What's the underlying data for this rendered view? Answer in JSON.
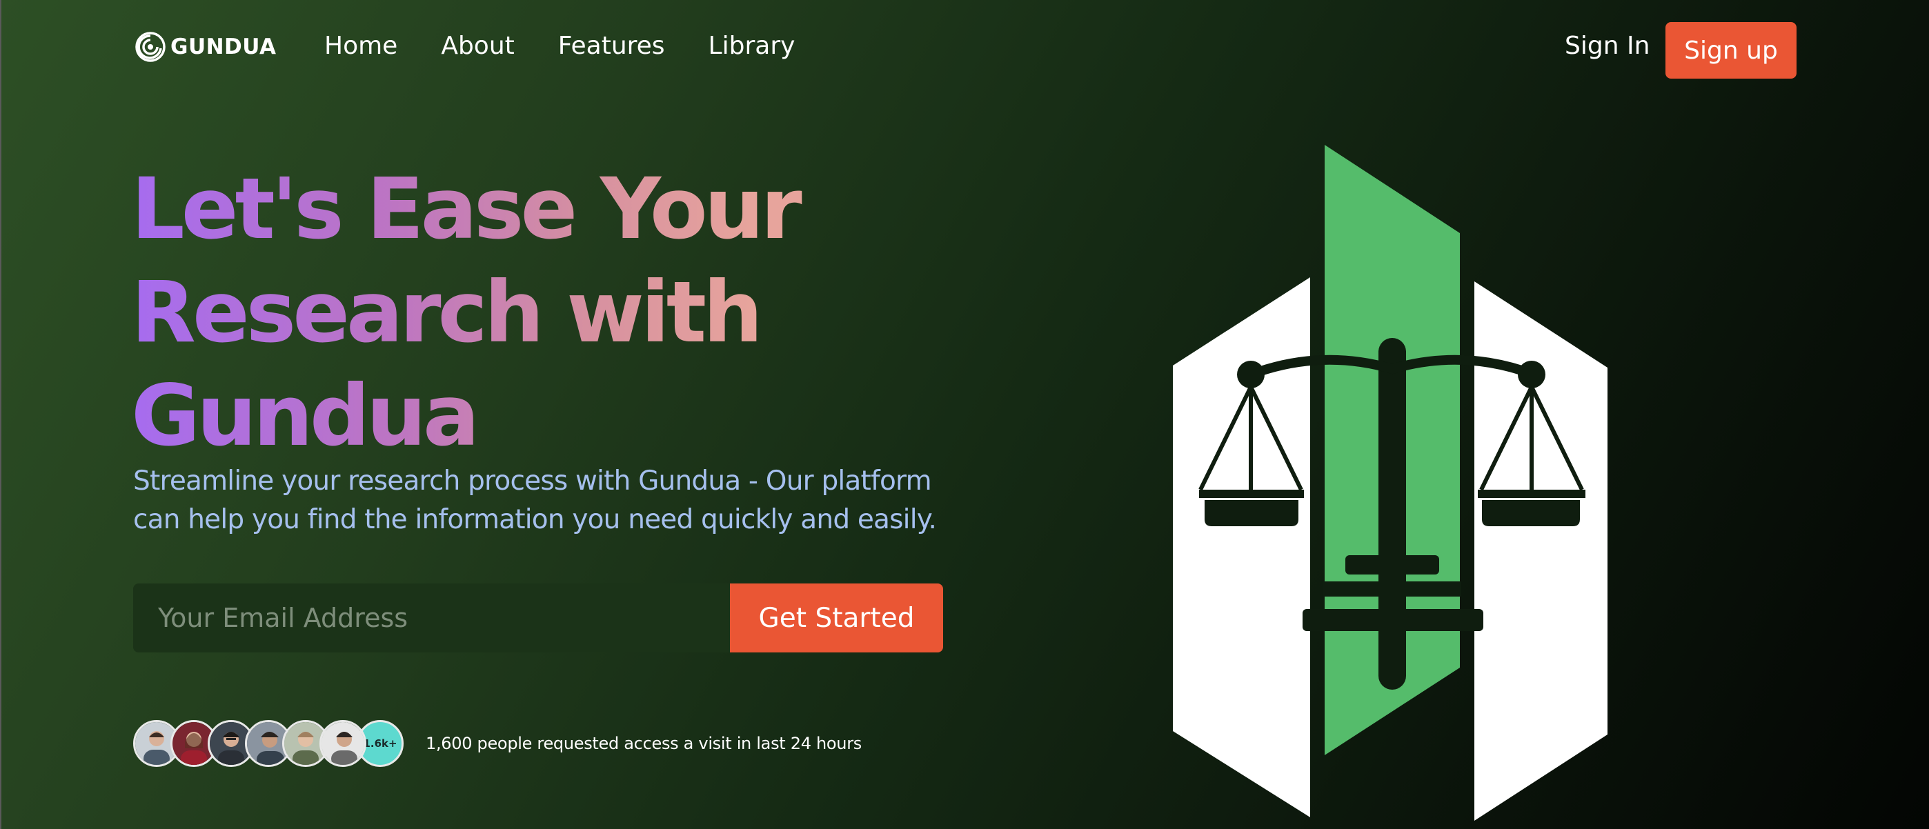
{
  "brand": {
    "name": "GUNDUA"
  },
  "nav": {
    "links": [
      "Home",
      "About",
      "Features",
      "Library"
    ],
    "sign_in": "Sign In",
    "sign_up": "Sign up"
  },
  "hero": {
    "title_lines": [
      "Let's Ease Your",
      "Research with",
      "Gundua"
    ],
    "subtitle": "Streamline your research process with Gundua - Our platform can help you find the information you need quickly and easily.",
    "email_placeholder": "Your Email Address",
    "email_value": "",
    "cta_label": "Get Started"
  },
  "social_proof": {
    "count_badge": "1.6k+",
    "text": "1,600 people requested access a visit in last 24 hours"
  },
  "colors": {
    "accent": "#ea5634",
    "title_gradient_start": "#a66cef",
    "title_gradient_end": "#e7a49c",
    "subtitle": "#a6c0ee",
    "illustration_green": "#55bc6b"
  },
  "icons": {
    "logo": "swirl-logo-icon",
    "illustration": "scales-of-justice-icon"
  }
}
